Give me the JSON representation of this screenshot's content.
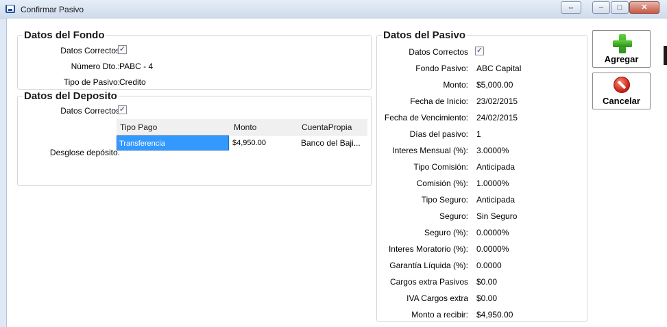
{
  "window": {
    "title": "Confirmar Pasivo"
  },
  "titlebar_buttons": {
    "restore": "⇔",
    "minimize": "–",
    "maximize": "□",
    "close": "✕"
  },
  "fondo": {
    "title": "Datos del Fondo",
    "datos_correctos_label": "Datos Correctos",
    "numero_label": "Número Dto.:",
    "numero_value": "PABC - 4",
    "tipo_label": "Tipo de Pasivo:",
    "tipo_value": "Credito"
  },
  "deposito": {
    "title": "Datos del Deposito",
    "datos_correctos_label": "Datos Correctos",
    "desglose_label": "Desglose depósito.",
    "columns": [
      "Tipo Pago",
      "Monto",
      "CuentaPropia"
    ],
    "rows": [
      {
        "tipo_pago": "Transferencia",
        "monto": "$4,950.00",
        "cuenta": "Banco del Baji..."
      }
    ]
  },
  "pasivo": {
    "title": "Datos del Pasivo",
    "datos_correctos_label": "Datos Correctos",
    "fields": [
      {
        "label": "Fondo Pasivo:",
        "value": "ABC Capital"
      },
      {
        "label": "Monto:",
        "value": "$5,000.00"
      },
      {
        "label": "Fecha de Inicio:",
        "value": "23/02/2015"
      },
      {
        "label": "Fecha de Vencimiento:",
        "value": "24/02/2015"
      },
      {
        "label": "Días del pasivo:",
        "value": "1"
      },
      {
        "label": "Interes Mensual (%):",
        "value": "3.0000%"
      },
      {
        "label": "Tipo Comisión:",
        "value": "Anticipada"
      },
      {
        "label": "Comisión (%):",
        "value": "1.0000%"
      },
      {
        "label": "Tipo Seguro:",
        "value": "Anticipada"
      },
      {
        "label": "Seguro:",
        "value": "Sin Seguro"
      },
      {
        "label": "Seguro (%):",
        "value": "0.0000%"
      },
      {
        "label": "Interes Moratorio (%):",
        "value": "0.0000%"
      },
      {
        "label": "Garantía Líquida (%):",
        "value": "0.0000"
      },
      {
        "label": "Cargos extra Pasivos",
        "value": "$0.00"
      },
      {
        "label": "IVA Cargos extra",
        "value": "$0.00"
      },
      {
        "label": "Monto a recibir:",
        "value": "$4,950.00"
      }
    ]
  },
  "actions": {
    "agregar": "Agregar",
    "cancelar": "Cancelar"
  },
  "checkmark": "✓"
}
